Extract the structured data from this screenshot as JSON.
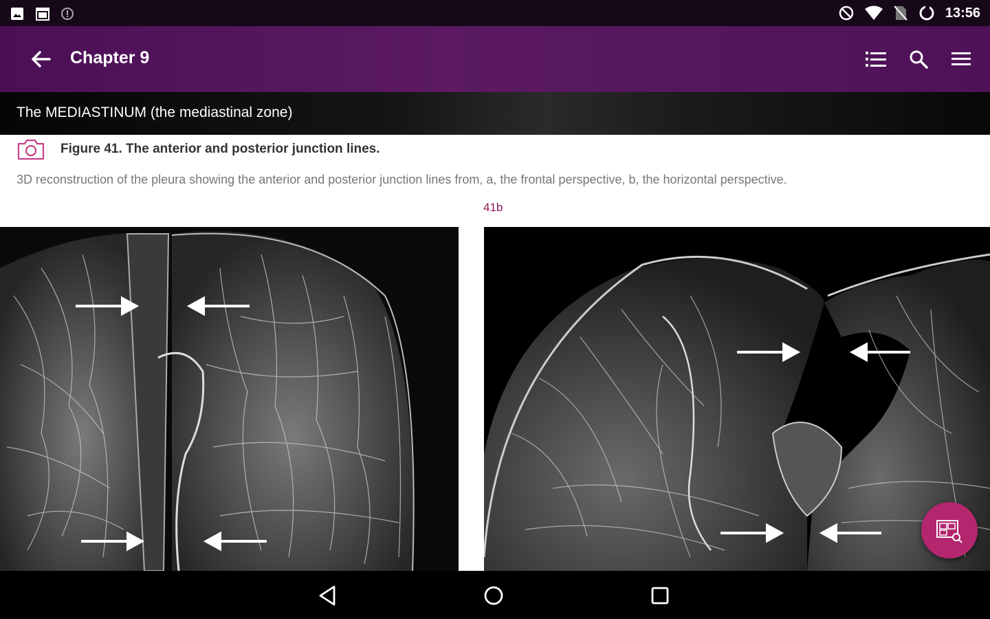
{
  "status_bar": {
    "time": "13:56",
    "left_icons": [
      "image-icon",
      "calendar-icon",
      "info-icon"
    ],
    "right_icons": [
      "do-not-disturb-icon",
      "wifi-icon",
      "no-sim-icon",
      "sync-icon"
    ]
  },
  "app_bar": {
    "title": "Chapter 9",
    "actions": [
      "list-icon",
      "search-icon",
      "menu-icon"
    ]
  },
  "section": {
    "title": "The MEDIASTINUM (the mediastinal zone)"
  },
  "figure": {
    "title": "Figure 41. The anterior and posterior junction lines.",
    "description": "3D reconstruction of the pleura showing the anterior and posterior junction lines from, a, the frontal perspective, b, the horizontal perspective.",
    "label": "41b"
  },
  "nav_bar": {
    "buttons": [
      "back-triangle-icon",
      "home-circle-icon",
      "recents-square-icon"
    ]
  },
  "colors": {
    "app_bar": "#4b0f55",
    "accent": "#b4266e",
    "figure_label": "#8c1a55"
  }
}
